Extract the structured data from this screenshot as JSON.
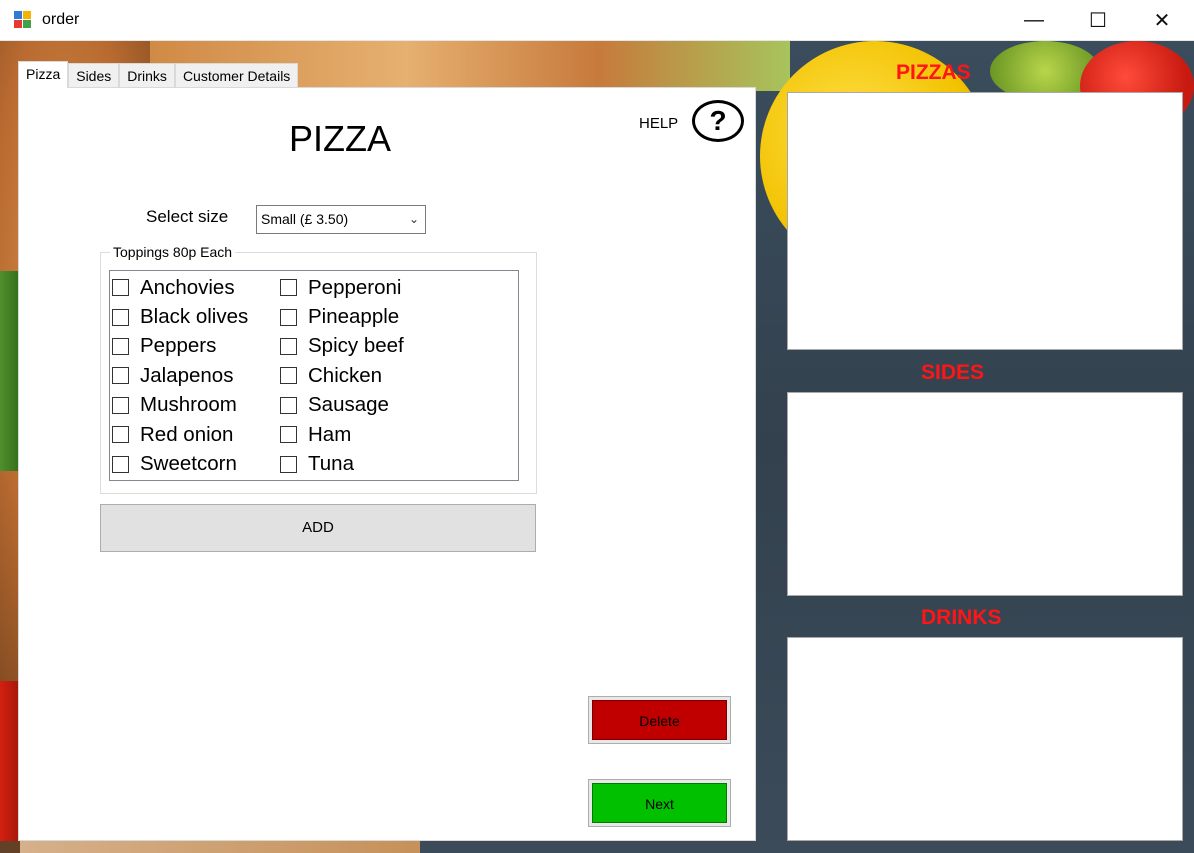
{
  "window": {
    "title": "order",
    "minimize_glyph": "—",
    "maximize_glyph": "☐",
    "close_glyph": "✕",
    "icon": "app-form-icon"
  },
  "tabs": [
    {
      "label": "Pizza",
      "active": true
    },
    {
      "label": "Sides",
      "active": false
    },
    {
      "label": "Drinks",
      "active": false
    },
    {
      "label": "Customer Details",
      "active": false
    }
  ],
  "pizza_page": {
    "title": "PIZZA",
    "help_label": "HELP",
    "help_glyph": "?",
    "size_label": "Select size",
    "size_selected": "Small (£ 3.50)",
    "toppings_legend": "Toppings 80p Each",
    "toppings_left": [
      "Anchovies",
      "Black olives",
      "Peppers",
      "Jalapenos",
      "Mushroom",
      "Red onion",
      "Sweetcorn"
    ],
    "toppings_right": [
      "Pepperoni",
      "Pineapple",
      "Spicy beef",
      "Chicken",
      "Sausage",
      "Ham",
      "Tuna"
    ],
    "add_label": "ADD",
    "delete_label": "Delete",
    "next_label": "Next"
  },
  "summary": {
    "pizzas_title": "PIZZAS",
    "sides_title": "SIDES",
    "drinks_title": "DRINKS"
  },
  "colors": {
    "section_title": "#ff1515",
    "delete_button": "#c00000",
    "next_button": "#00c000"
  }
}
